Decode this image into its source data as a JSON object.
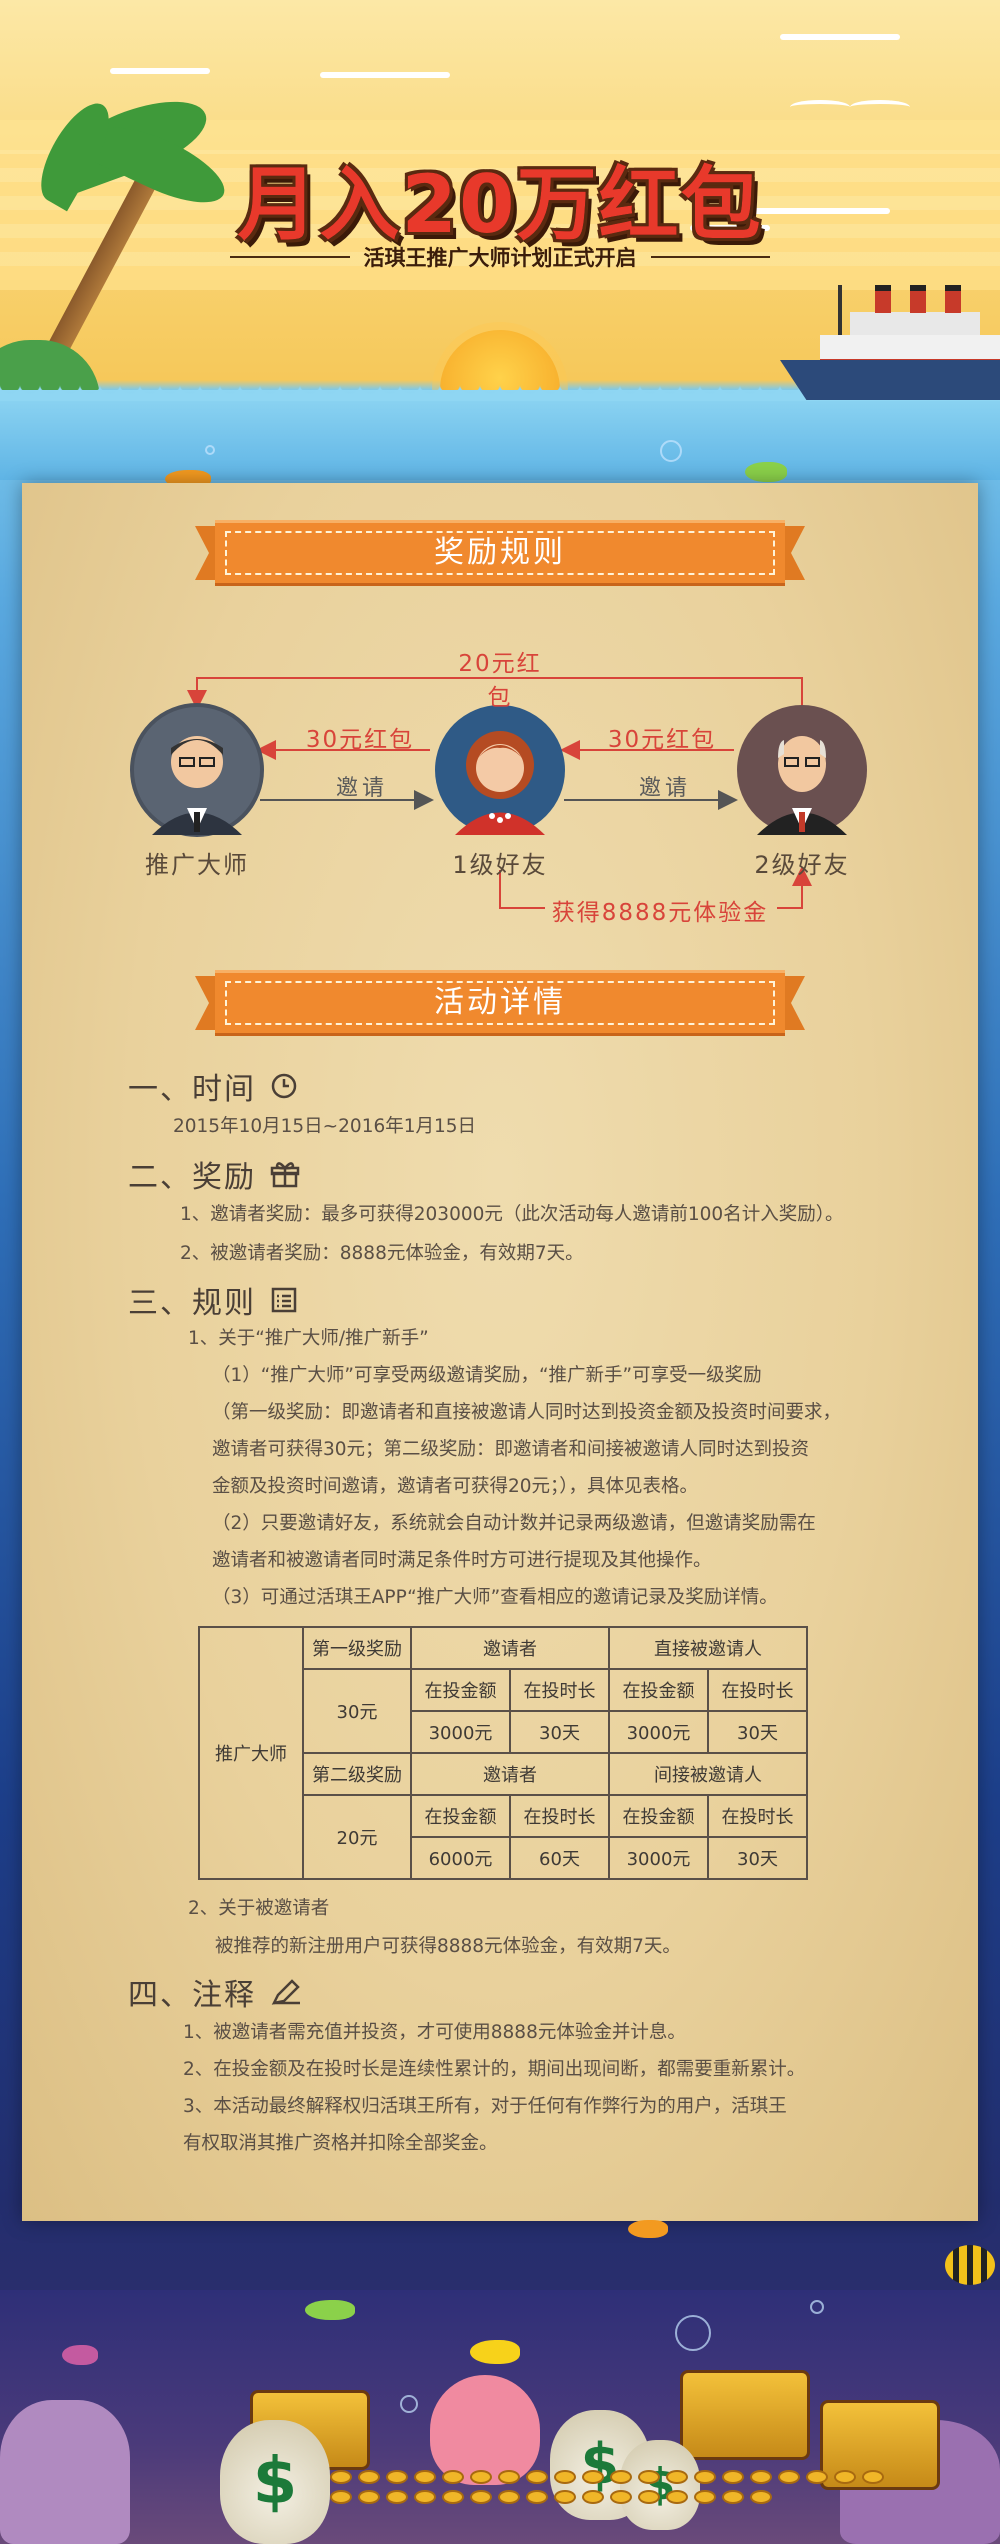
{
  "header": {
    "title": "月入20万红包",
    "subtitle": "活琪王推广大师计划正式开启"
  },
  "rules_section": {
    "banner": "奖励规则",
    "roles": [
      "推广大师",
      "1级好友",
      "2级好友"
    ],
    "arrow_top": "20元红包",
    "arrow_left_reward": "30元红包",
    "arrow_right_reward": "30元红包",
    "invite_left": "邀请",
    "invite_right": "邀请",
    "gain": "获得8888元体验金"
  },
  "details_section": {
    "banner": "活动详情",
    "time": {
      "heading": "一、时间",
      "icon": "clock-icon",
      "text": "2015年10月15日~2016年1月15日"
    },
    "reward": {
      "heading": "二、奖励",
      "icon": "gift-icon",
      "items": [
        "1、邀请者奖励：最多可获得203000元（此次活动每人邀请前100名计入奖励）。",
        "2、被邀请者奖励：8888元体验金，有效期7天。"
      ]
    },
    "rules": {
      "heading": "三、规则",
      "icon": "list-icon",
      "sub1": "1、关于“推广大师/推广新手”",
      "lines": [
        "（1）“推广大师”可享受两级邀请奖励，“推广新手”可享受一级奖励",
        "（第一级奖励：即邀请者和直接被邀请人同时达到投资金额及投资时间要求，",
        "邀请者可获得30元；第二级奖励：即邀请者和间接被邀请人同时达到投资",
        "金额及投资时间邀请，邀请者可获得20元；），具体见表格。",
        "（2）只要邀请好友，系统就会自动计数并记录两级邀请，但邀请奖励需在",
        "邀请者和被邀请者同时满足条件时方可进行提现及其他操作。",
        "（3）可通过活琪王APP“推广大师”查看相应的邀请记录及奖励详情。"
      ],
      "table": {
        "role": "推广大师",
        "level1": "第一级奖励",
        "level1_amount": "30元",
        "level2": "第二级奖励",
        "level2_amount": "20元",
        "inviter": "邀请者",
        "direct": "直接被邀请人",
        "indirect": "间接被邀请人",
        "amount_col": "在投金额",
        "duration_col": "在投时长",
        "row1": [
          "3000元",
          "30天",
          "3000元",
          "30天"
        ],
        "row2": [
          "6000元",
          "60天",
          "3000元",
          "30天"
        ]
      },
      "sub2": "2、关于被邀请者",
      "sub2_text": "被推荐的新注册用户可获得8888元体验金，有效期7天。"
    },
    "notes": {
      "heading": "四、注释",
      "icon": "pencil-icon",
      "items": [
        "1、被邀请者需充值并投资，才可使用8888元体验金并计息。",
        "2、在投金额及在投时长是连续性累计的，期间出现间断，都需要重新累计。",
        "3、本活动最终解释权归活琪王所有，对于任何有作弊行为的用户，活琪王",
        "有权取消其推广资格并扣除全部奖金。"
      ]
    }
  },
  "colors": {
    "banner_orange": "#f0892e",
    "title_red": "#e8392b",
    "reward_red": "#d8443a"
  }
}
